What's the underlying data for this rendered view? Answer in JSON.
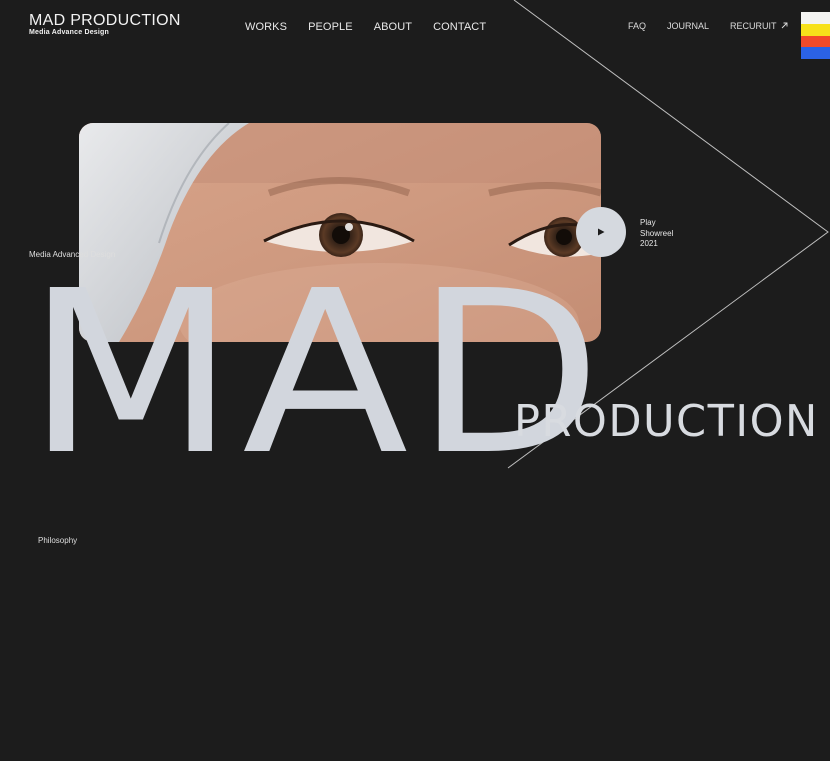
{
  "logo": {
    "title": "MAD PRODUCTION",
    "subtitle": "Media Advance Design"
  },
  "nav_main": [
    {
      "label": "WORKS"
    },
    {
      "label": "PEOPLE"
    },
    {
      "label": "ABOUT"
    },
    {
      "label": "CONTACT"
    }
  ],
  "nav_sub": {
    "faq": "FAQ",
    "journal": "JOURNAL",
    "recruit": "RECURUIT",
    "recruit_icon": "arrow-up-right-icon"
  },
  "flags_colors": [
    "#f3f3f1",
    "#f7e11a",
    "#f24a2a",
    "#2b62e6"
  ],
  "hero": {
    "tagline": "Media Advanced Design",
    "play_icon": "play-icon",
    "play_line1": "Play",
    "play_line2": "Showreel",
    "play_line3": "2021"
  },
  "title": {
    "big": "MAD",
    "small": "PRODUCTION"
  },
  "section": {
    "philosophy": "Philosophy"
  },
  "colors": {
    "background": "#1c1c1c",
    "accent_title": "#d2d6dd"
  }
}
